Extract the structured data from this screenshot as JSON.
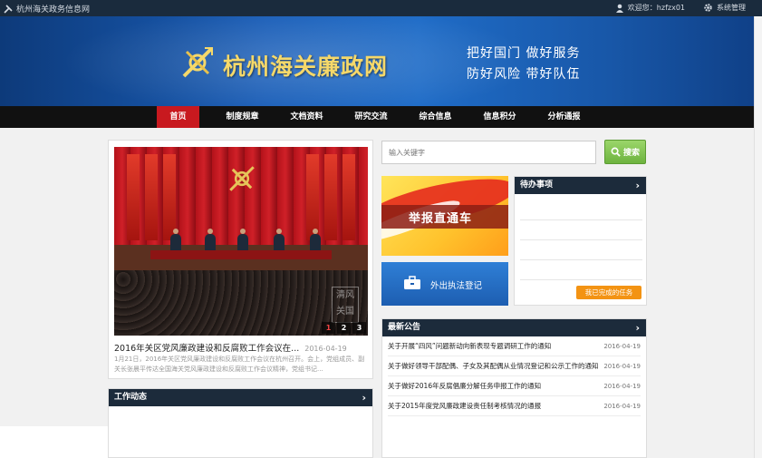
{
  "topbar": {
    "site_name": "杭州海关政务信息网",
    "welcome": "欢迎您：hzfzx01",
    "admin_label": "系统管理"
  },
  "banner": {
    "title": "杭州海关廉政网",
    "slogan_line1": "把好国门  做好服务",
    "slogan_line2": "防好风险  带好队伍"
  },
  "nav": {
    "items": [
      {
        "label": "首页",
        "active": true
      },
      {
        "label": "制度规章"
      },
      {
        "label": "文档资料"
      },
      {
        "label": "研究交流"
      },
      {
        "label": "综合信息"
      },
      {
        "label": "信息积分"
      },
      {
        "label": "分析通报"
      }
    ]
  },
  "featured": {
    "stamp_text": "清风关国",
    "pages": [
      "1",
      "2",
      "3"
    ],
    "title": "2016年关区党风廉政建设和反腐败工作会议在...",
    "date": "2016-04-19",
    "description": "1月21日，2016年关区党风廉政建设和反腐败工作会议在杭州召开。会上，党组成员、副关长张晨平传达全国海关党风廉政建设和反腐败工作会议精神，党组书记..."
  },
  "work_news": {
    "title": "工作动态"
  },
  "search": {
    "placeholder": "输入关键字",
    "button_label": "搜索"
  },
  "tiles": {
    "report": "举报直通车",
    "outside": "外出执法登记"
  },
  "todo": {
    "title": "待办事项",
    "done_button": "我已完成的任务"
  },
  "notices": {
    "title": "最新公告",
    "items": [
      {
        "title": "关于开展“四风”问题新动向新表现专题调研工作的通知",
        "date": "2016-04-19"
      },
      {
        "title": "关于做好领导干部配偶、子女及其配偶从业情况登记和公示工作的通知",
        "date": "2016-04-19"
      },
      {
        "title": "关于做好2016年反腐倡廉分解任务申报工作的通知",
        "date": "2016-04-19"
      },
      {
        "title": "关于2015年度党风廉政建设责任制考核情况的通报",
        "date": "2016-04-19"
      }
    ]
  }
}
